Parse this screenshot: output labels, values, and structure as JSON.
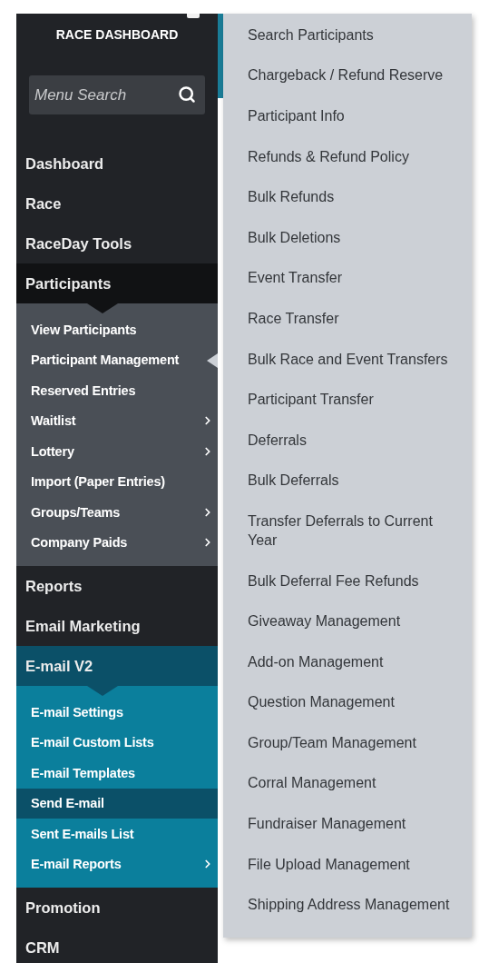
{
  "sidebar": {
    "title": "RACE DASHBOARD",
    "search": {
      "placeholder": "Menu Search"
    },
    "items": [
      {
        "label": "Dashboard",
        "kind": "plain"
      },
      {
        "label": "Race",
        "kind": "plain"
      },
      {
        "label": "RaceDay Tools",
        "kind": "plain"
      },
      {
        "label": "Participants",
        "kind": "slate",
        "expanded": true,
        "children": [
          {
            "label": "View Participants",
            "has_submenu": false,
            "selected": false,
            "flyout_open": false
          },
          {
            "label": "Participant Management",
            "has_submenu": false,
            "selected": false,
            "flyout_open": true
          },
          {
            "label": "Reserved Entries",
            "has_submenu": false,
            "selected": false,
            "flyout_open": false
          },
          {
            "label": "Waitlist",
            "has_submenu": true,
            "selected": false,
            "flyout_open": false
          },
          {
            "label": "Lottery",
            "has_submenu": true,
            "selected": false,
            "flyout_open": false
          },
          {
            "label": "Import (Paper Entries)",
            "has_submenu": false,
            "selected": false,
            "flyout_open": false
          },
          {
            "label": "Groups/Teams",
            "has_submenu": true,
            "selected": false,
            "flyout_open": false
          },
          {
            "label": "Company Paids",
            "has_submenu": true,
            "selected": false,
            "flyout_open": false
          }
        ]
      },
      {
        "label": "Reports",
        "kind": "plain"
      },
      {
        "label": "Email Marketing",
        "kind": "plain"
      },
      {
        "label": "E-mail V2",
        "kind": "teal",
        "expanded": true,
        "children": [
          {
            "label": "E-mail Settings",
            "has_submenu": false,
            "selected": false,
            "flyout_open": false
          },
          {
            "label": "E-mail Custom Lists",
            "has_submenu": false,
            "selected": false,
            "flyout_open": false
          },
          {
            "label": "E-mail Templates",
            "has_submenu": false,
            "selected": false,
            "flyout_open": false
          },
          {
            "label": "Send E-mail",
            "has_submenu": false,
            "selected": true,
            "flyout_open": false
          },
          {
            "label": "Sent E-mails List",
            "has_submenu": false,
            "selected": false,
            "flyout_open": false
          },
          {
            "label": "E-mail Reports",
            "has_submenu": true,
            "selected": false,
            "flyout_open": false
          }
        ]
      },
      {
        "label": "Promotion",
        "kind": "plain"
      },
      {
        "label": "CRM",
        "kind": "plain"
      }
    ]
  },
  "flyout": {
    "items": [
      "Search Participants",
      "Chargeback / Refund Reserve",
      "Participant Info",
      "Refunds & Refund Policy",
      "Bulk Refunds",
      "Bulk Deletions",
      "Event Transfer",
      "Race Transfer",
      "Bulk Race and Event Transfers",
      "Participant Transfer",
      "Deferrals",
      "Bulk Deferrals",
      "Transfer Deferrals to Current Year",
      "Bulk Deferral Fee Refunds",
      "Giveaway Management",
      "Add-on Management",
      "Question Management",
      "Group/Team Management",
      "Corral Management",
      "Fundraiser Management",
      "File Upload Management",
      "Shipping Address Management"
    ]
  }
}
